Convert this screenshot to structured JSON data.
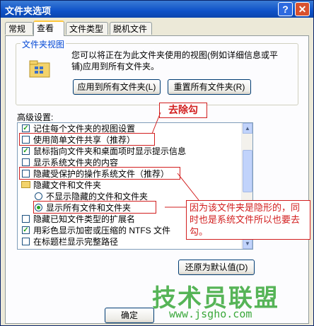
{
  "window": {
    "title": "文件夹选项",
    "help_glyph": "?",
    "close_glyph": "✕"
  },
  "tabs": [
    "常规",
    "查看",
    "文件类型",
    "脱机文件"
  ],
  "folder_views": {
    "group_title": "文件夹视图",
    "description": "您可以将正在为此文件夹使用的视图(例如详细信息或平铺)应用到所有文件夹。",
    "apply_button": "应用到所有文件夹(L)",
    "reset_button": "重置所有文件夹(R)"
  },
  "advanced": {
    "label": "高级设置:",
    "items": [
      {
        "kind": "check",
        "checked": true,
        "label": "记住每个文件夹的视图设置"
      },
      {
        "kind": "check",
        "checked": false,
        "label": "使用简单文件共享（推荐）"
      },
      {
        "kind": "check",
        "checked": true,
        "label": "鼠标指向文件夹和桌面项时显示提示信息"
      },
      {
        "kind": "check",
        "checked": false,
        "label": "显示系统文件夹的内容"
      },
      {
        "kind": "check",
        "checked": false,
        "label": "隐藏受保护的操作系统文件（推荐）"
      },
      {
        "kind": "folder",
        "label": "隐藏文件和文件夹"
      },
      {
        "kind": "radio",
        "checked": false,
        "label": "不显示隐藏的文件和文件夹"
      },
      {
        "kind": "radio",
        "checked": true,
        "label": "显示所有文件和文件夹"
      },
      {
        "kind": "check",
        "checked": false,
        "label": "隐藏已知文件类型的扩展名"
      },
      {
        "kind": "check",
        "checked": true,
        "label": "用彩色显示加密或压缩的 NTFS 文件"
      },
      {
        "kind": "check",
        "checked": false,
        "label": "在标题栏显示完整路径"
      }
    ]
  },
  "restore_button": "还原为默认值(D)",
  "ok_button": "确定",
  "annotations": {
    "remove_tick": "去除勾",
    "explanation": "因为该文件夹是隐形的，同时也是系统文件所以也要去勾。"
  },
  "watermark": {
    "text": "技术员联盟",
    "url": "www.jsgho.com"
  },
  "colors": {
    "accent_check": "#21a121",
    "annotation_red": "#d21f1f",
    "title_blue": "#0f52c8"
  }
}
